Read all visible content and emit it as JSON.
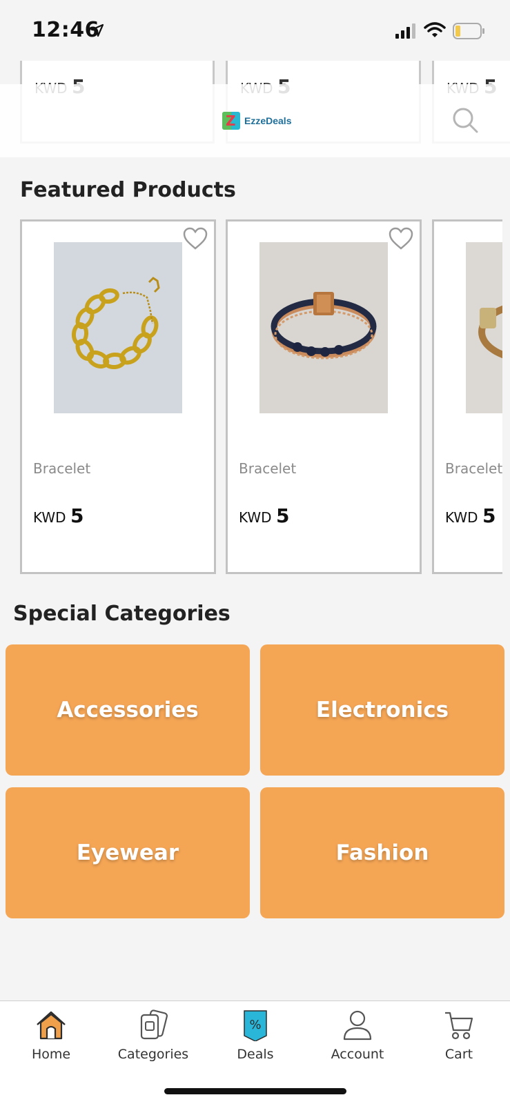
{
  "status_bar": {
    "time": "12:46"
  },
  "header": {
    "brand_name": "EzzeDeals"
  },
  "peek_cards": [
    {
      "currency": "KWD",
      "price": "5"
    },
    {
      "currency": "KWD",
      "price": "5"
    },
    {
      "currency": "KWD",
      "price": "5"
    }
  ],
  "featured": {
    "title": "Featured Products",
    "products": [
      {
        "name": "Bracelet",
        "currency": "KWD",
        "price": "5"
      },
      {
        "name": "Bracelet",
        "currency": "KWD",
        "price": "5"
      },
      {
        "name": "Bracelet",
        "currency": "KWD",
        "price": "5"
      }
    ]
  },
  "special_categories": {
    "title": "Special Categories",
    "items": [
      {
        "label": "Accessories"
      },
      {
        "label": "Electronics"
      },
      {
        "label": "Eyewear"
      },
      {
        "label": "Fashion"
      }
    ]
  },
  "tabbar": {
    "items": [
      {
        "label": "Home",
        "icon": "home-icon",
        "active": true
      },
      {
        "label": "Categories",
        "icon": "categories-icon"
      },
      {
        "label": "Deals",
        "icon": "deals-icon"
      },
      {
        "label": "Account",
        "icon": "account-icon"
      },
      {
        "label": "Cart",
        "icon": "cart-icon"
      }
    ]
  },
  "colors": {
    "accent": "#f5a655",
    "home_icon": "#f0a04b",
    "deals_icon": "#29b6d8"
  }
}
